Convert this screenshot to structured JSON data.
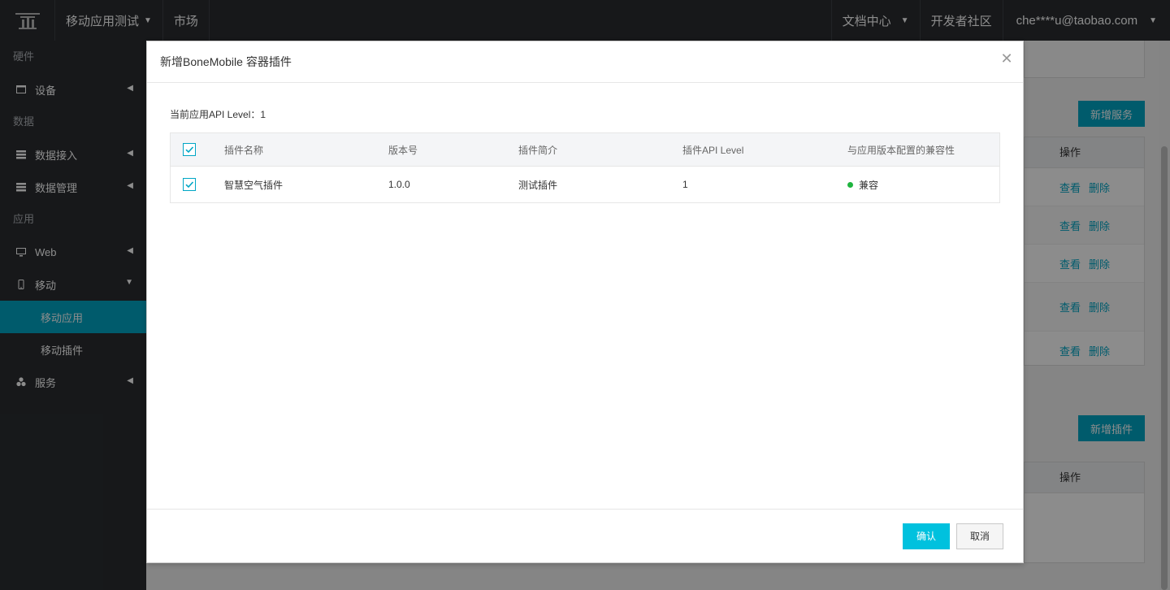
{
  "topbar": {
    "app_select": "移动应用测试",
    "market": "市场",
    "docs": "文档中心",
    "community": "开发者社区",
    "user": "che****u@taobao.com"
  },
  "sidebar": {
    "sections": [
      "硬件",
      "数据",
      "应用"
    ],
    "items": {
      "device": "设备",
      "data_access": "数据接入",
      "data_manage": "数据管理",
      "web": "Web",
      "mobile": "移动",
      "mobile_app": "移动应用",
      "mobile_plugin": "移动插件",
      "service": "服务"
    }
  },
  "background_page": {
    "add_service": "新增服务",
    "add_plugin": "新增插件",
    "ops_header": "操作",
    "view": "查看",
    "delete": "删除"
  },
  "modal": {
    "title": "新增BoneMobile 容器插件",
    "api_level": "当前应用API Level：1",
    "columns": [
      "插件名称",
      "版本号",
      "插件简介",
      "插件API Level",
      "与应用版本配置的兼容性"
    ],
    "rows": [
      {
        "name": "智慧空气插件",
        "version": "1.0.0",
        "desc": "测试插件",
        "api_level": "1",
        "compat": "兼容",
        "checked": true
      }
    ],
    "confirm": "确认",
    "cancel": "取消"
  },
  "colors": {
    "accent": "#00a6c5",
    "primary_button": "#00c1de",
    "compat_dot": "#1fb43f",
    "topbar_bg": "#2a2d31"
  }
}
